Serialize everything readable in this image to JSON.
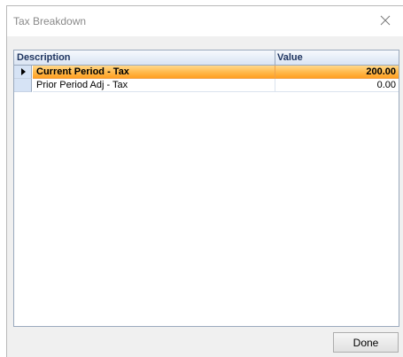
{
  "window": {
    "title": "Tax Breakdown",
    "close_icon": "close-icon"
  },
  "grid": {
    "columns": [
      "Description",
      "Value"
    ],
    "rows": [
      {
        "description": "Current Period - Tax",
        "value": "200.00",
        "selected": true
      },
      {
        "description": "Prior Period Adj - Tax",
        "value": "0.00",
        "selected": false
      }
    ]
  },
  "footer": {
    "done_label": "Done"
  },
  "colors": {
    "selected_row": "#ffb84a",
    "header_text": "#1f3560",
    "dialog_background": "#f0f0f0"
  }
}
